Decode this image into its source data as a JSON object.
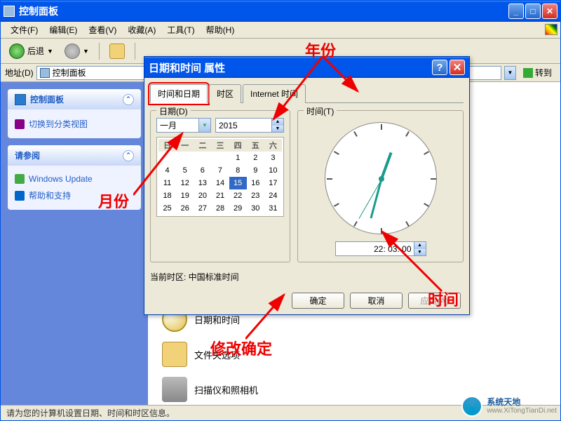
{
  "window": {
    "title": "控制面板"
  },
  "menu": {
    "file": "文件(F)",
    "edit": "编辑(E)",
    "view": "查看(V)",
    "fav": "收藏(A)",
    "tools": "工具(T)",
    "help": "帮助(H)"
  },
  "toolbar": {
    "back": "后退"
  },
  "addressbar": {
    "label": "地址(D)",
    "value": "控制面板",
    "goto": "转到"
  },
  "sidebar": {
    "panel1": {
      "title": "控制面板",
      "link1": "切换到分类视图"
    },
    "panel2": {
      "title": "请参阅",
      "link1": "Windows Update",
      "link2": "帮助和支持"
    }
  },
  "items": {
    "datetime": "日期和时间",
    "folder": "文件夹选项",
    "scanner": "扫描仪和照相机"
  },
  "statusbar": {
    "text": "请为您的计算机设置日期、时间和时区信息。"
  },
  "dialog": {
    "title": "日期和时间 属性",
    "tabs": {
      "datetime": "时间和日期",
      "timezone": "时区",
      "internet": "Internet 时间"
    },
    "date_group": "日期(D)",
    "time_group": "时间(T)",
    "month": "一月",
    "year": "2015",
    "weekdays": [
      "日",
      "一",
      "二",
      "三",
      "四",
      "五",
      "六"
    ],
    "calendar": [
      [
        "",
        "",
        "",
        "",
        "1",
        "2",
        "3"
      ],
      [
        "4",
        "5",
        "6",
        "7",
        "8",
        "9",
        "10"
      ],
      [
        "11",
        "12",
        "13",
        "14",
        "15",
        "16",
        "17"
      ],
      [
        "18",
        "19",
        "20",
        "21",
        "22",
        "23",
        "24"
      ],
      [
        "25",
        "26",
        "27",
        "28",
        "29",
        "30",
        "31"
      ]
    ],
    "selected_day": "15",
    "time_value": "22: 03: 00",
    "current_tz": "当前时区: 中国标准时间",
    "ok": "确定",
    "cancel": "取消",
    "apply": "应用(A)"
  },
  "annotations": {
    "year": "年份",
    "month": "月份",
    "time": "时间",
    "confirm": "修改确定"
  },
  "watermark": {
    "line1": "系统天地",
    "line2": "www.XiTongTianDi.net"
  }
}
